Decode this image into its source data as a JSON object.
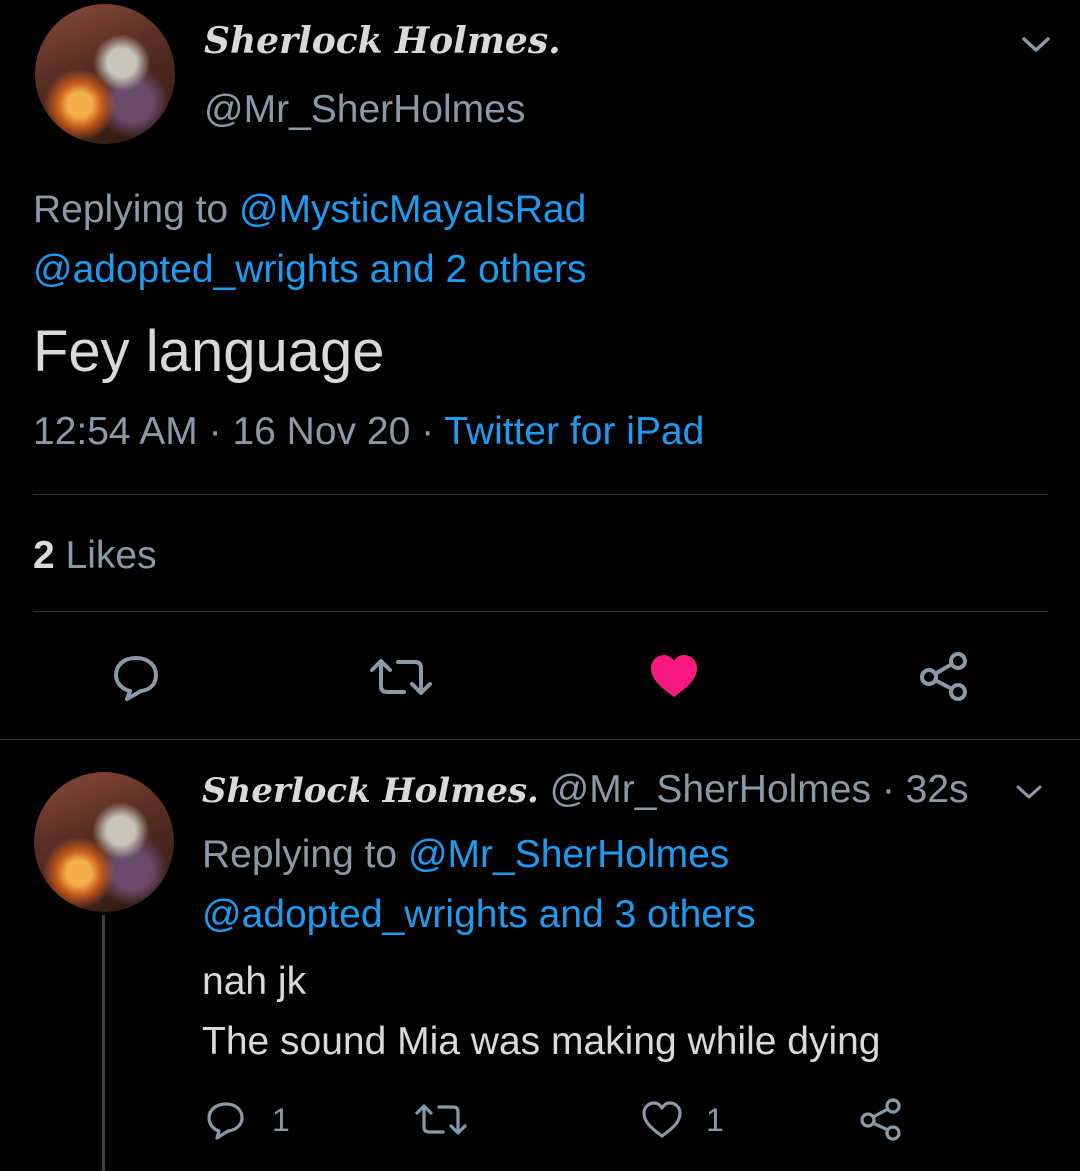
{
  "main_tweet": {
    "display_name": "Sherlock Holmes.",
    "handle": "@Mr_SherHolmes",
    "replying_prefix": "Replying to",
    "replying_user": "@MysticMayaIsRad",
    "replying_more": "@adopted_wrights and 2 others",
    "text": "Fey language",
    "time": "12:54 AM",
    "sep1": "·",
    "date": "16 Nov 20",
    "sep2": "·",
    "source": "Twitter for iPad",
    "likes_count": "2",
    "likes_label": "Likes",
    "like_color": "#f91880"
  },
  "reply_tweet": {
    "display_name": "Sherlock Holmes.",
    "handle": "@Mr_SherHolmes",
    "time": "· 32s",
    "replying_prefix": "Replying to",
    "replying_user": "@Mr_SherHolmes",
    "replying_more": "@adopted_wrights and 3 others",
    "text_line1": "nah jk",
    "text_line2": "The sound Mia was making while dying",
    "reply_count": "1",
    "like_count": "1"
  },
  "colors": {
    "background": "#000000",
    "text": "#d9d9d9",
    "secondary": "#8b98a5",
    "accent": "#1d9bf0",
    "divider": "#2f3336"
  },
  "icons": [
    "chevron-down-icon",
    "reply-icon",
    "retweet-icon",
    "heart-icon",
    "share-icon"
  ]
}
